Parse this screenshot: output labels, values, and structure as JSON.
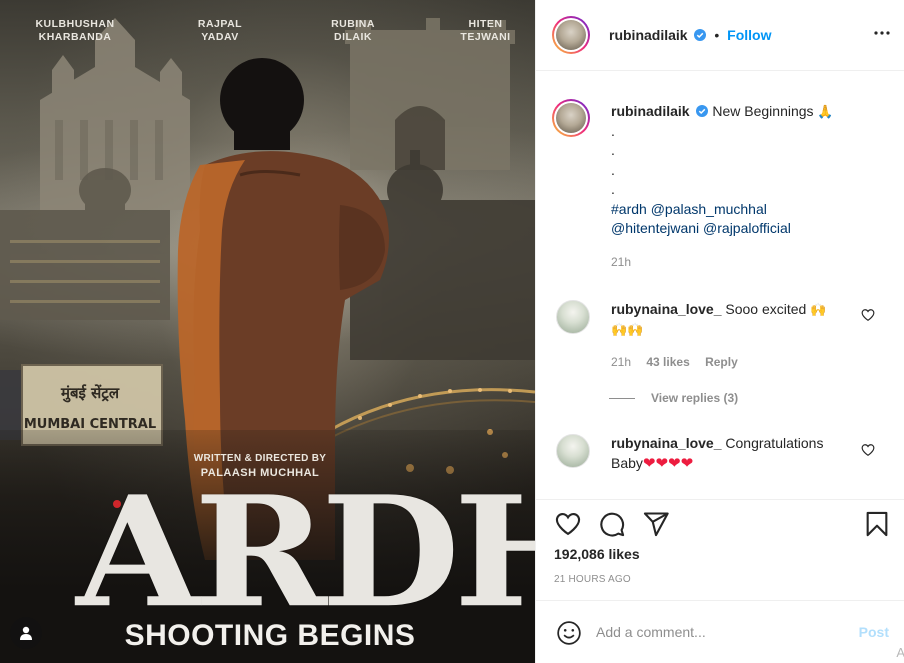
{
  "poster": {
    "cast": [
      {
        "first": "KULBHUSHAN",
        "last": "KHARBANDA"
      },
      {
        "first": "RAJPAL",
        "last": "YADAV"
      },
      {
        "first": "RUBINA",
        "last": "DILAIK"
      },
      {
        "first": "HITEN",
        "last": "TEJWANI"
      }
    ],
    "credit_line1": "WRITTEN & DIRECTED BY",
    "credit_line2": "PALAASH MUCHHAL",
    "title": "ARDH",
    "subtitle": "SHOOTING BEGINS",
    "station_sign_text": "मुंबई सेंट्रल",
    "station_sign_en": "MUMBAI CENTRAL",
    "accent_color": "#d0262b"
  },
  "header": {
    "username": "rubinadilaik",
    "separator": "•",
    "follow_label": "Follow",
    "more_icon": "more-horizontal-icon"
  },
  "caption": {
    "username": "rubinadilaik",
    "text": "New Beginnings",
    "emoji": "🙏",
    "dots": [
      ".",
      ".",
      ".",
      "."
    ],
    "tags_line1": "#ardh @palash_muchhal",
    "tags_line2": "@hitentejwani @rajpalofficial",
    "time": "21h"
  },
  "comments": [
    {
      "username": "rubynaina_love_",
      "text": "Sooo excited",
      "emoji_inline": "🙌",
      "emoji_line2": "🙌🙌",
      "time": "21h",
      "likes": "43 likes",
      "reply": "Reply",
      "view_replies": "View replies (3)"
    },
    {
      "username": "rubynaina_love_",
      "text": "Congratulations",
      "text_line2": "Baby",
      "hearts": "❤❤❤❤"
    }
  ],
  "actions": {
    "like_icon": "heart-outline-icon",
    "comment_icon": "comment-bubble-icon",
    "share_icon": "paper-plane-icon",
    "save_icon": "bookmark-icon",
    "likes_count": "192,086 likes",
    "posted_ago": "21 HOURS AGO"
  },
  "add_comment": {
    "placeholder": "Add a comment...",
    "post_label": "Post",
    "corner_text": "A"
  },
  "colors": {
    "link_blue": "#0095f6",
    "tag_blue": "#00376b",
    "muted": "#8e8e8e",
    "post_disabled": "#b2dffc"
  }
}
